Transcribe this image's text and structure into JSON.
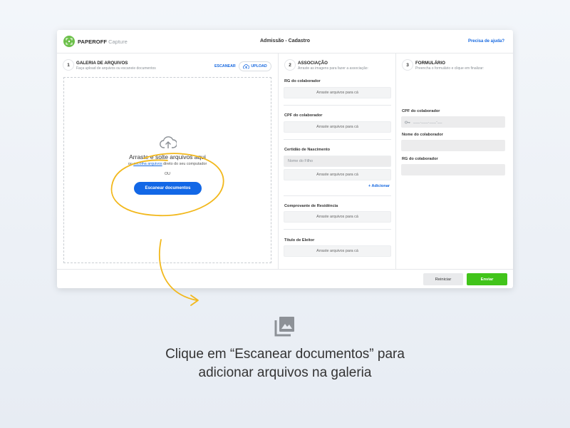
{
  "colors": {
    "accent": "#1267e6",
    "link": "#1769e0",
    "brand_green": "#6cc04a",
    "send_green": "#41c41a",
    "annotation_yellow": "#f2b81c"
  },
  "app": {
    "brand": "PAPEROFF",
    "brand_sub": "Capture",
    "title": "Admissão - Cadastro",
    "help": "Precisa de ajuda?"
  },
  "gallery": {
    "step": "1",
    "title": "GALERIA DE ARQUIVOS",
    "subtitle": "Faça upload de arquivos ou escaneie documentos",
    "scan_label": "ESCANEAR",
    "upload_label": "UPLOAD",
    "drop_text": "Arraste e solte arquivos aqui",
    "choose_prefix": "ou",
    "choose_link": "escolha arquivos",
    "choose_suffix": "direto do seu computador",
    "or_text": "OU",
    "scan_button": "Escanear documentos",
    "icon": "cloud-upload-icon"
  },
  "association": {
    "step": "2",
    "title": "ASSOCIAÇÃO",
    "subtitle": "Arraste as imagens para fazer a associação:",
    "drop_placeholder": "Arraste arquivos para cá",
    "groups": [
      {
        "label": "RG do colaborador"
      },
      {
        "label": "CPF do colaborador"
      },
      {
        "label": "Certidão de Nascimento",
        "input_placeholder": "Nome do Filho",
        "add_label": "+ Adicionar"
      },
      {
        "label": "Comprovante de Residência"
      },
      {
        "label": "Título de Eleitor"
      }
    ]
  },
  "form": {
    "step": "3",
    "title": "FORMULÁRIO",
    "subtitle": "Preencha o formulário e clique em finalizar:",
    "fields": [
      {
        "label": "CPF do colaborador",
        "placeholder": "___.___.___-__",
        "icon": "key-icon"
      },
      {
        "label": "Nome do colaborador",
        "placeholder": ""
      },
      {
        "label": "RG do colaborador",
        "placeholder": ""
      }
    ]
  },
  "footer": {
    "reset": "Reiniciar",
    "send": "Enviar"
  },
  "caption": {
    "icon": "photo-gallery-icon",
    "line1": "Clique em “Escanear documentos” para",
    "line2": "adicionar arquivos na galeria"
  }
}
